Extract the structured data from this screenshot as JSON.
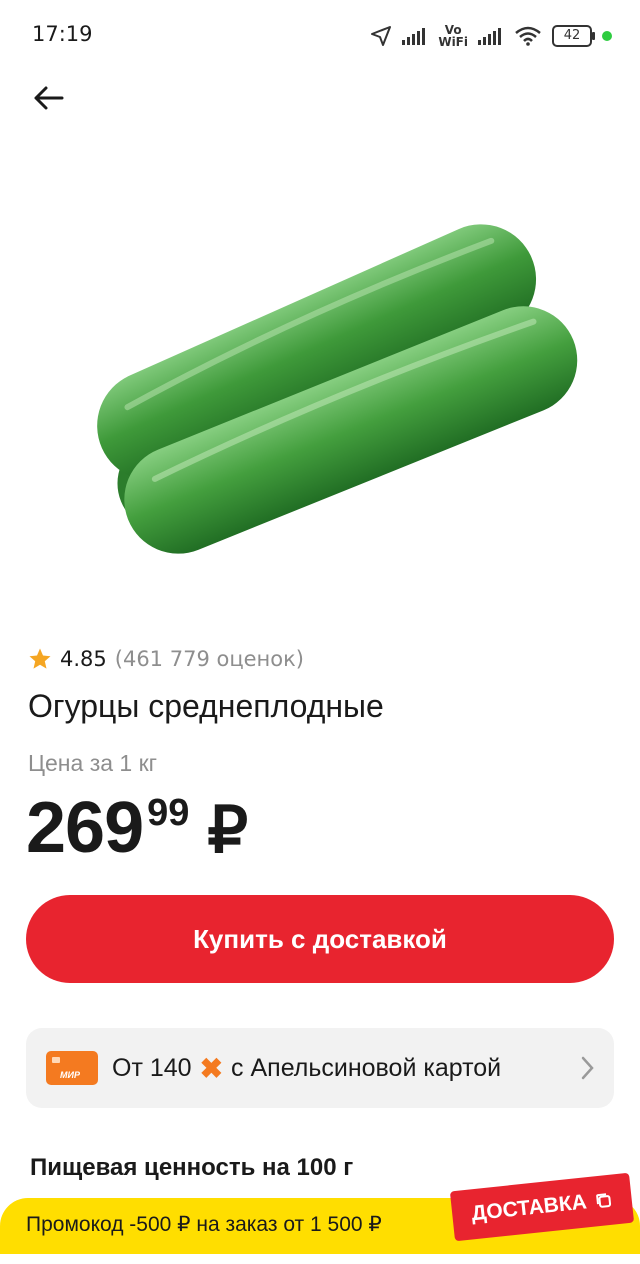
{
  "status_bar": {
    "time": "17:19",
    "vowifi_top": "Vo",
    "vowifi_bottom": "WiFi",
    "battery": "42"
  },
  "product": {
    "image_label": "cucumber-photo",
    "rating": "4.85",
    "rating_count": "(461 779 оценок)",
    "title": "Огурцы среднеплодные",
    "price_label": "Цена за 1 кг",
    "price_int": "269",
    "price_dec": "99",
    "currency": "₽"
  },
  "actions": {
    "buy_label": "Купить с доставкой"
  },
  "card_offer": {
    "prefix": "От 140",
    "suffix": "с Апельсиновой картой",
    "card_brand": "МИР"
  },
  "nutrition": {
    "title": "Пищевая ценность на 100 г"
  },
  "promo": {
    "text": "Промокод -500 ₽ на заказ от 1 500 ₽",
    "badge": "ДОСТАВКА"
  },
  "colors": {
    "accent_red": "#e8242f",
    "promo_yellow": "#ffde00",
    "card_orange": "#f47a20"
  }
}
